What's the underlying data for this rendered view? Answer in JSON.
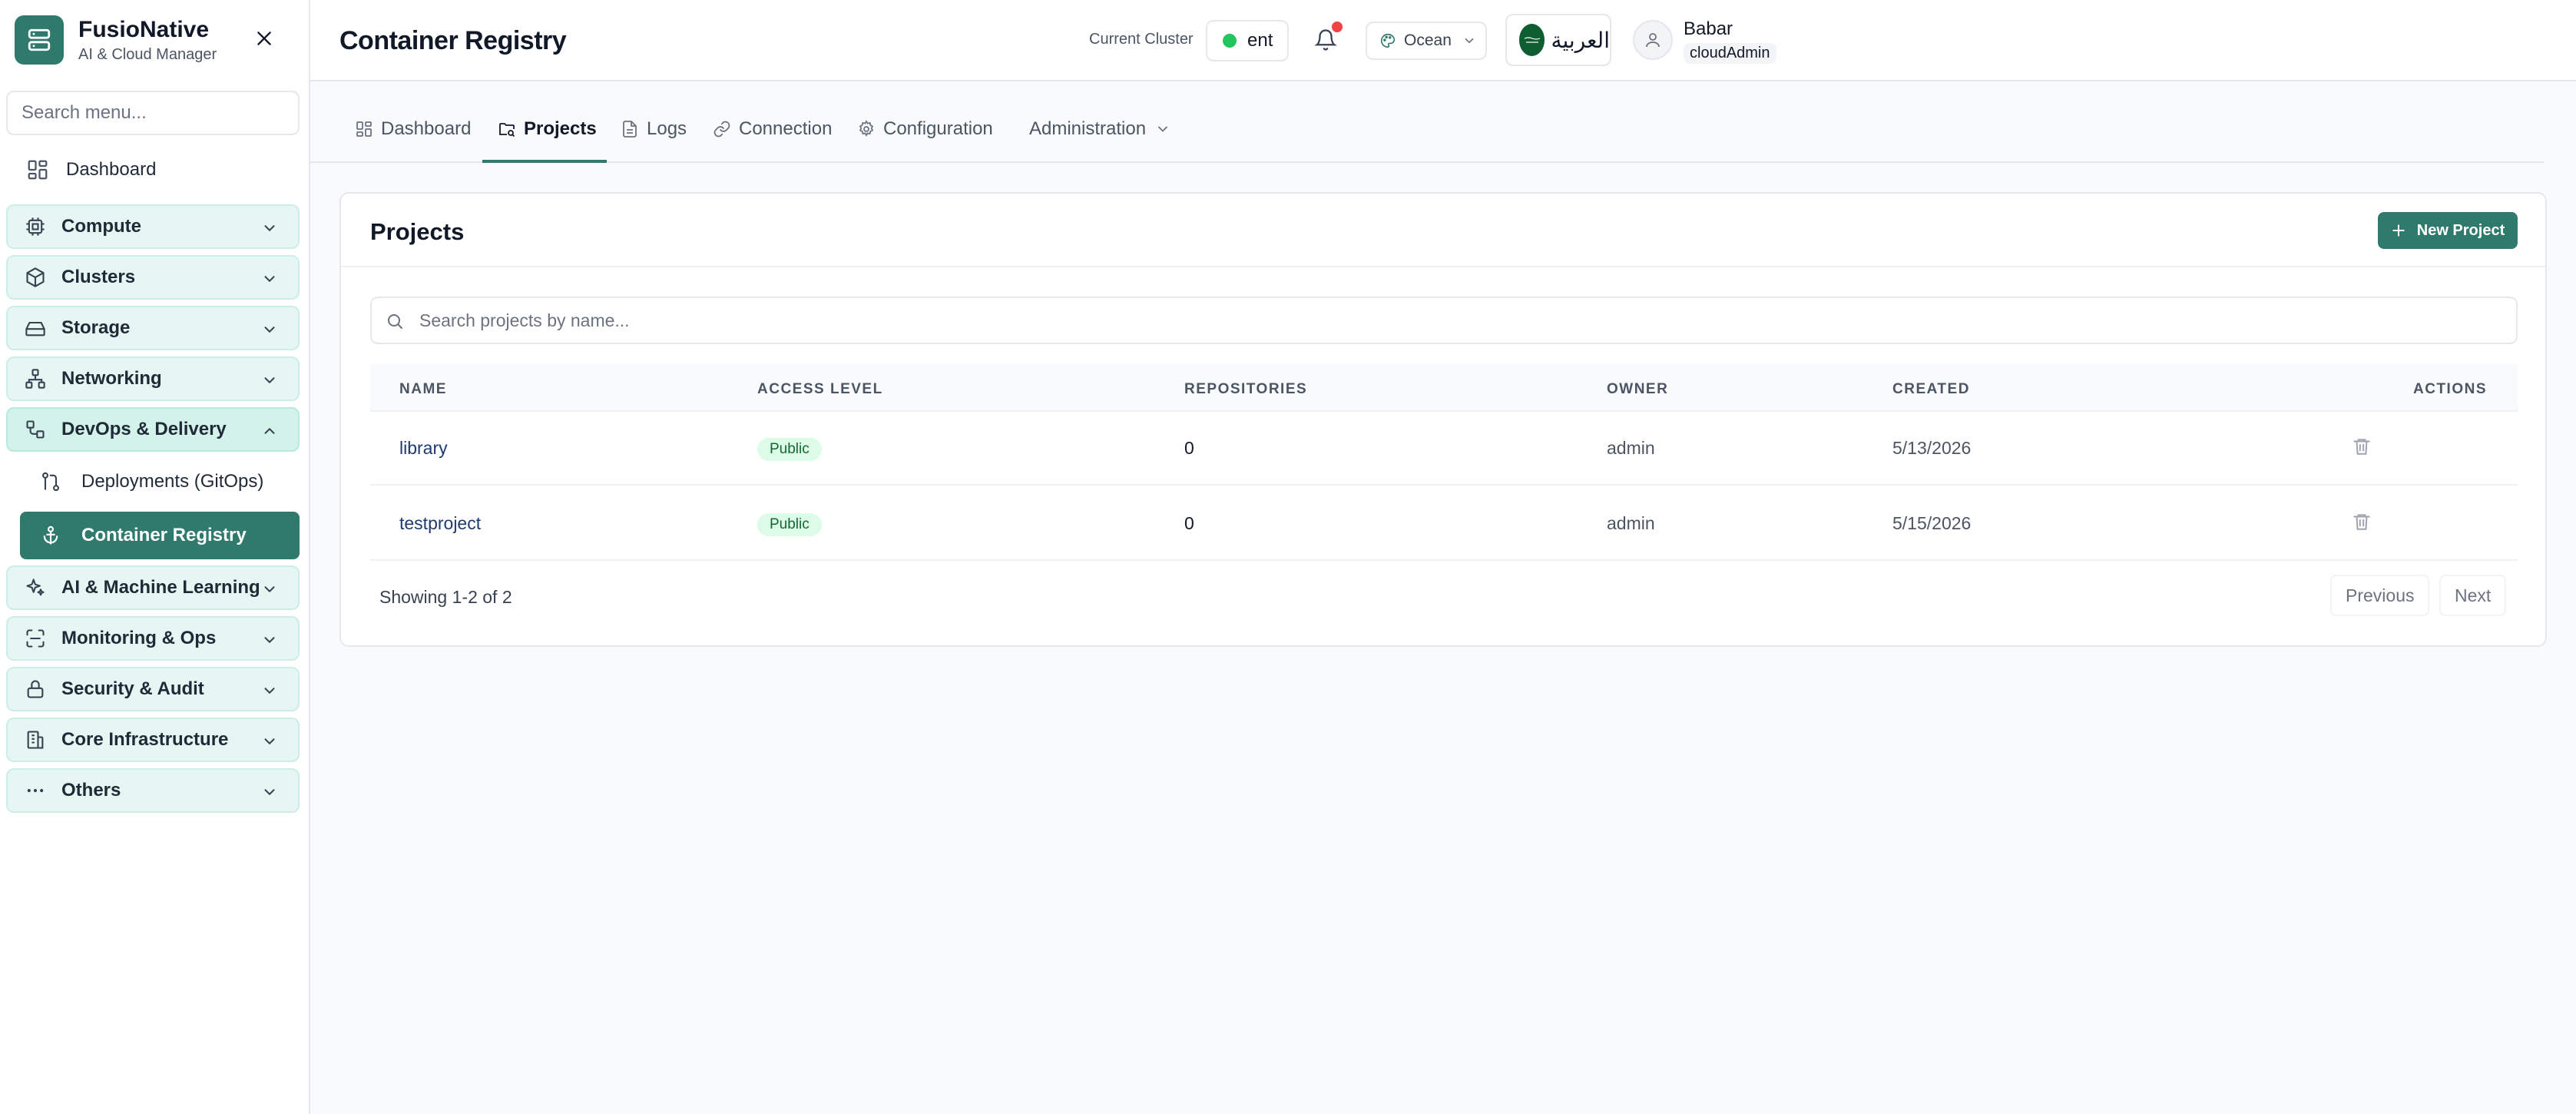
{
  "brand": {
    "name": "FusioNative",
    "subtitle": "AI & Cloud Manager"
  },
  "sidebar": {
    "search_placeholder": "Search menu...",
    "dashboard_label": "Dashboard",
    "groups": [
      {
        "label": "Compute"
      },
      {
        "label": "Clusters"
      },
      {
        "label": "Storage"
      },
      {
        "label": "Networking"
      },
      {
        "label": "DevOps & Delivery"
      },
      {
        "label": "AI & Machine Learning"
      },
      {
        "label": "Monitoring & Ops"
      },
      {
        "label": "Security & Audit"
      },
      {
        "label": "Core Infrastructure"
      },
      {
        "label": "Others"
      }
    ],
    "devops_items": [
      {
        "label": "Deployments (GitOps)"
      },
      {
        "label": "Container Registry"
      }
    ]
  },
  "header": {
    "title": "Container Registry",
    "cluster_label": "Current Cluster",
    "cluster_value": "ent",
    "theme": "Ocean",
    "language": "العربية",
    "user_name": "Babar",
    "user_role": "cloudAdmin"
  },
  "tabs": [
    {
      "label": "Dashboard"
    },
    {
      "label": "Projects"
    },
    {
      "label": "Logs"
    },
    {
      "label": "Connection"
    },
    {
      "label": "Configuration"
    },
    {
      "label": "Administration"
    }
  ],
  "projects": {
    "title": "Projects",
    "new_button": "New Project",
    "search_placeholder": "Search projects by name...",
    "columns": [
      "NAME",
      "ACCESS LEVEL",
      "REPOSITORIES",
      "OWNER",
      "CREATED",
      "ACTIONS"
    ],
    "rows": [
      {
        "name": "library",
        "access": "Public",
        "repositories": "0",
        "owner": "admin",
        "created": "5/13/2026"
      },
      {
        "name": "testproject",
        "access": "Public",
        "repositories": "0",
        "owner": "admin",
        "created": "5/15/2026"
      }
    ],
    "showing": "Showing 1-2 of 2",
    "prev": "Previous",
    "next": "Next"
  },
  "colors": {
    "accent": "#2f7a6c",
    "group_bg": "#e6f7f3",
    "status_dot": "#22c55e",
    "badge_bg": "#dcfce7"
  }
}
